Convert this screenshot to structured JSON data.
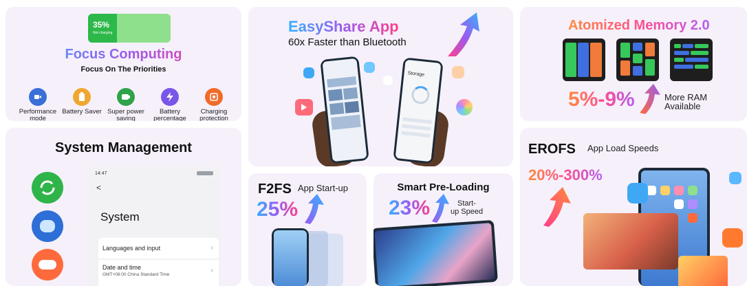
{
  "focus": {
    "battery_percent": "35%",
    "battery_sub": "Not charging",
    "battery_level": 0.35,
    "title": "Focus Computing",
    "subtitle": "Focus On The Priorities",
    "features": [
      {
        "label": "Performance mode",
        "icon": "performance-icon",
        "color": "#3a6fd8"
      },
      {
        "label": "Battery Saver",
        "icon": "battery-saver-icon",
        "color": "#f0a732"
      },
      {
        "label": "Super power saving",
        "icon": "super-power-saving-icon",
        "color": "#2fa24a"
      },
      {
        "label": "Battery percentage",
        "icon": "battery-percentage-icon",
        "color": "#7a56e8"
      },
      {
        "label": "Charging protection",
        "icon": "charging-protection-icon",
        "color": "#f06b2a"
      }
    ]
  },
  "easyshare": {
    "title": "EasyShare App",
    "subtitle": "60x Faster than Bluetooth",
    "phone_right_title": "Storage"
  },
  "memory": {
    "title": "Atomized Memory 2.0",
    "range": "5%-9%",
    "note_line1": "More RAM",
    "note_line2": "Available"
  },
  "system": {
    "title": "System Management",
    "status_time": "14:47",
    "back_glyph": "<",
    "page_title": "System",
    "rows": [
      {
        "label": "Languages and input",
        "sub": ""
      },
      {
        "label": "Date and time",
        "sub": "GMT+08:00 China Standard Time"
      }
    ]
  },
  "f2fs": {
    "title": "F2FS",
    "sub": "App Start-up",
    "percent": "25%"
  },
  "preload": {
    "title": "Smart Pre-Loading",
    "percent": "23%",
    "sub_line1": "Start-",
    "sub_line2": "up Speed"
  },
  "erofs": {
    "title": "EROFS",
    "sub": "App Load Speeds",
    "range": "20%-300%"
  },
  "colors": {
    "card_bg": "#f6f0fb",
    "battery_green": "#8ee08c",
    "accent_blue": "#36b0ff",
    "accent_pink": "#ff3f8a"
  }
}
